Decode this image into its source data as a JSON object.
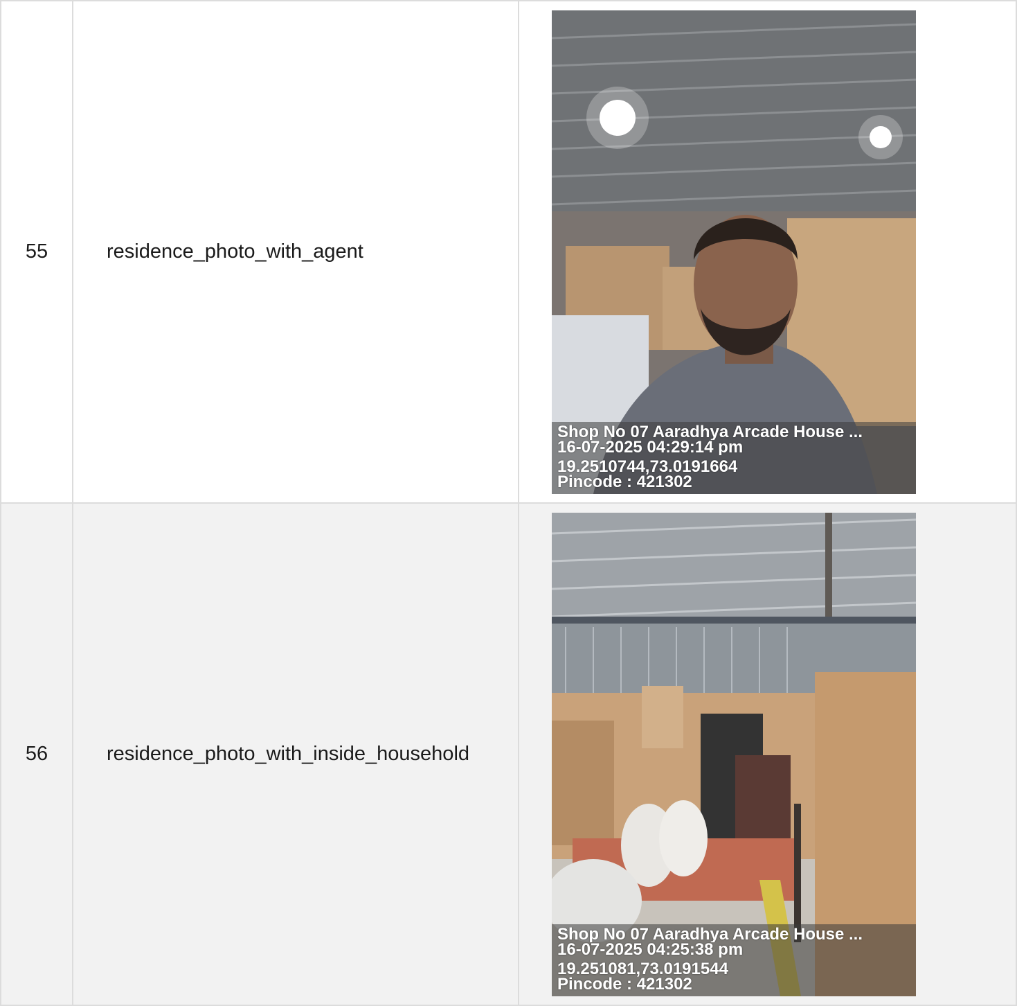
{
  "rows": [
    {
      "number": "55",
      "field": "residence_photo_with_agent",
      "photo": {
        "address": "Shop No 07 Aaradhya Arcade House ...",
        "datetime": "16-07-2025 04:29:14 pm",
        "coords": "19.2510744,73.0191664",
        "pincode": "Pincode : 421302"
      }
    },
    {
      "number": "56",
      "field": "residence_photo_with_inside_household",
      "photo": {
        "address": "Shop No 07 Aaradhya Arcade House ...",
        "datetime": "16-07-2025 04:25:38 pm",
        "coords": "19.251081,73.0191544",
        "pincode": "Pincode : 421302"
      }
    }
  ]
}
